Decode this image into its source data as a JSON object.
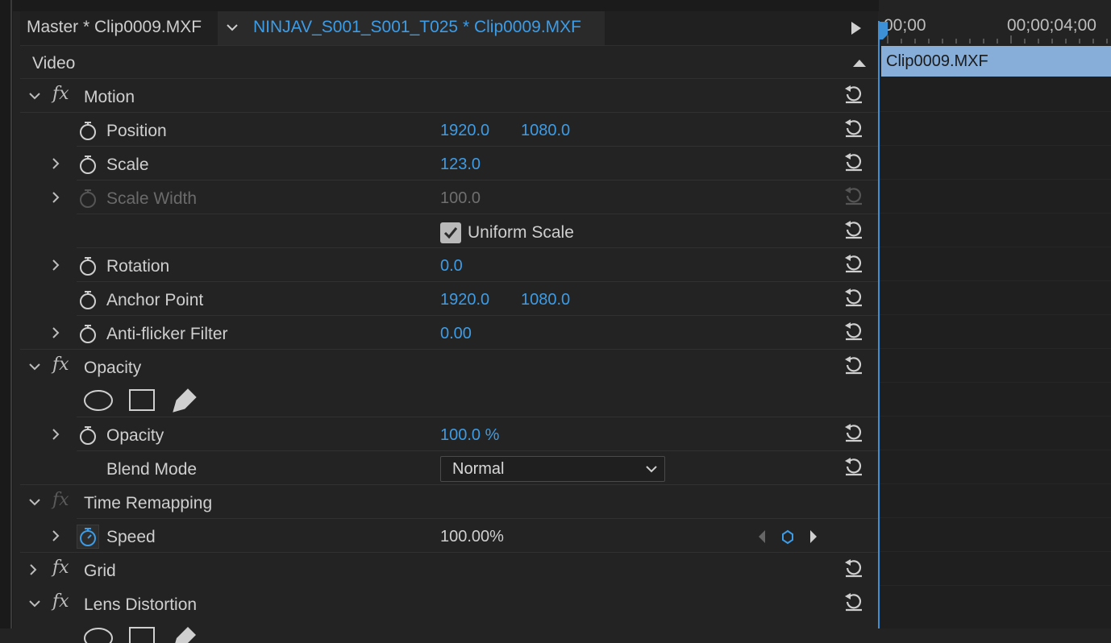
{
  "tabs": {
    "master": "Master * Clip0009.MXF",
    "clip": "NINJAV_S001_S001_T025 * Clip0009.MXF"
  },
  "section": {
    "label": "Video"
  },
  "motion": {
    "name": "Motion",
    "position": {
      "label": "Position",
      "x": "1920.0",
      "y": "1080.0"
    },
    "scale": {
      "label": "Scale",
      "value": "123.0"
    },
    "scale_width": {
      "label": "Scale Width",
      "value": "100.0"
    },
    "uniform_scale": {
      "label": "Uniform Scale",
      "checked": true
    },
    "rotation": {
      "label": "Rotation",
      "value": "0.0"
    },
    "anchor_point": {
      "label": "Anchor Point",
      "x": "1920.0",
      "y": "1080.0"
    },
    "anti_flicker": {
      "label": "Anti-flicker Filter",
      "value": "0.00"
    }
  },
  "opacity": {
    "name": "Opacity",
    "opacity": {
      "label": "Opacity",
      "value": "100.0 %"
    },
    "blend_mode": {
      "label": "Blend Mode",
      "value": "Normal"
    }
  },
  "time_remapping": {
    "name": "Time Remapping",
    "speed": {
      "label": "Speed",
      "value": "100.00%"
    }
  },
  "grid": {
    "name": "Grid"
  },
  "lens_distortion": {
    "name": "Lens Distortion"
  },
  "timeline": {
    "timecode_start": "00;00",
    "timecode_mark": "00;00;04;00",
    "clip_name": "Clip0009.MXF"
  },
  "colors": {
    "accent": "#3d9ce6",
    "clip_bar": "#86aed8",
    "panel_bg": "#232323"
  },
  "icons": {
    "stopwatch": "stopwatch-icon",
    "reset": "reset-icon",
    "twisty": "chevron-icon",
    "fx": "fx-icon"
  }
}
